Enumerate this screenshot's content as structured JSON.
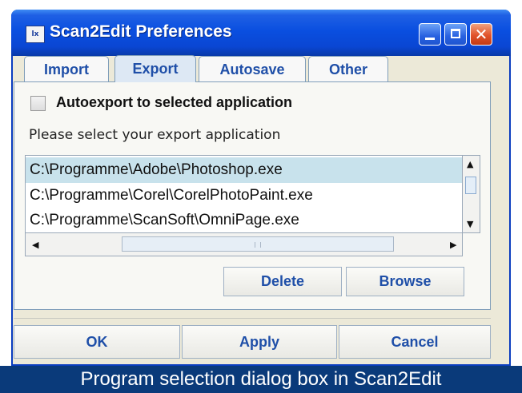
{
  "window": {
    "title": "Scan2Edit Preferences",
    "app_icon_text": "lx",
    "close_glyph": "✕"
  },
  "tabs": [
    {
      "label": "Import",
      "active": false
    },
    {
      "label": "Export",
      "active": true
    },
    {
      "label": "Autosave",
      "active": false
    },
    {
      "label": "Other",
      "active": false
    }
  ],
  "export": {
    "autoexport_label": "Autoexport to selected application",
    "autoexport_checked": false,
    "prompt": "Please select your export application",
    "applications": [
      {
        "path": "C:\\Programme\\Adobe\\Photoshop.exe",
        "selected": true
      },
      {
        "path": "C:\\Programme\\Corel\\CorelPhotoPaint.exe",
        "selected": false
      },
      {
        "path": "C:\\Programme\\ScanSoft\\OmniPage.exe",
        "selected": false
      }
    ],
    "delete_label": "Delete",
    "browse_label": "Browse"
  },
  "scroll_glyphs": {
    "up": "▲",
    "down": "▼",
    "left": "◀",
    "right": "▶"
  },
  "footer": {
    "ok_label": "OK",
    "apply_label": "Apply",
    "cancel_label": "Cancel"
  },
  "caption": "Program selection dialog box in Scan2Edit",
  "colors": {
    "titlebar": "#0a4fe0",
    "tab_text": "#1f4fa8",
    "selected_row": "#c8e2ec",
    "caption_bg": "#0a3a7a"
  }
}
